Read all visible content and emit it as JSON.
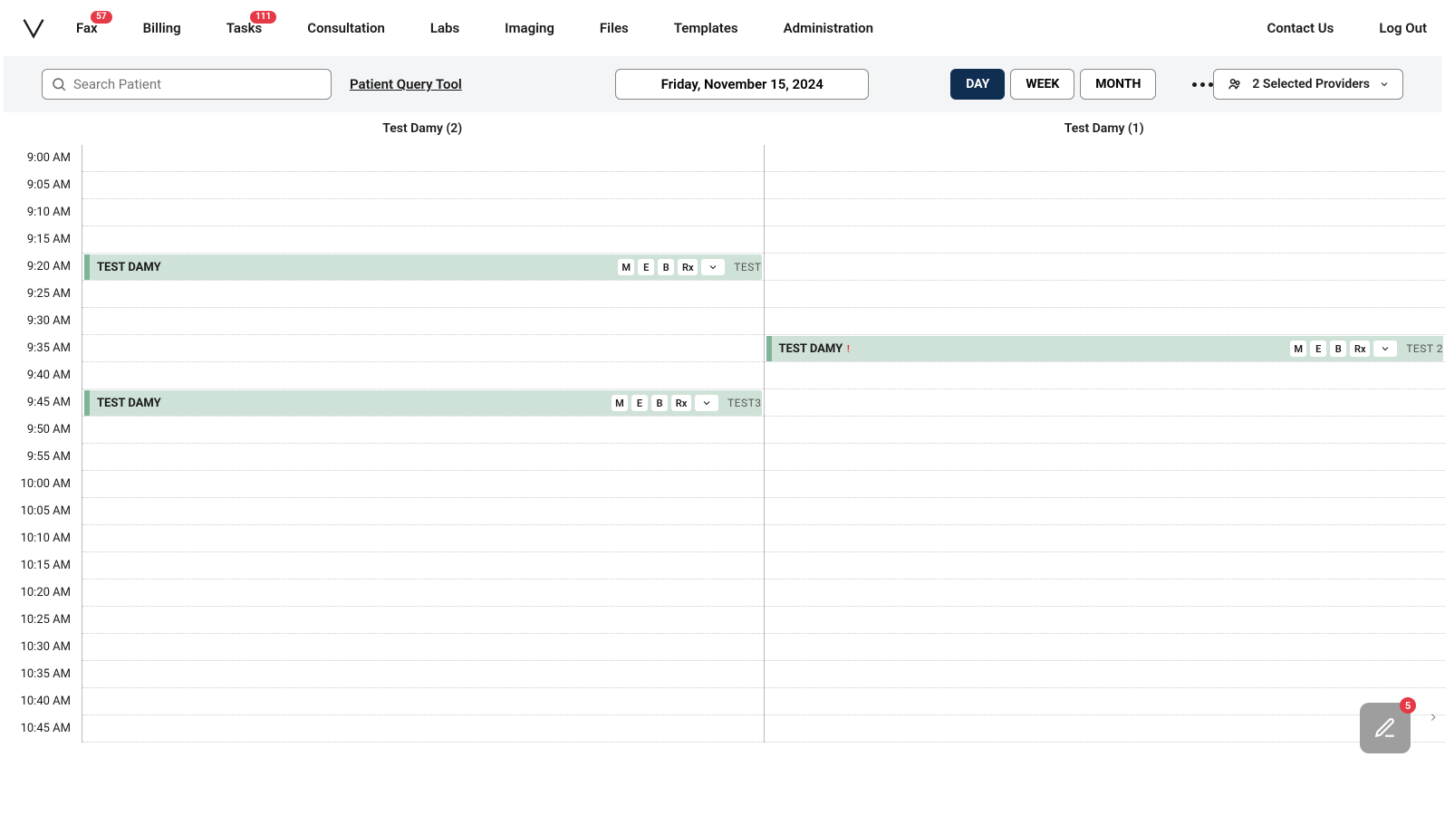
{
  "nav": {
    "items": [
      {
        "label": "Fax",
        "badge": "57"
      },
      {
        "label": "Billing"
      },
      {
        "label": "Tasks",
        "badge": "111"
      },
      {
        "label": "Consultation"
      },
      {
        "label": "Labs"
      },
      {
        "label": "Imaging"
      },
      {
        "label": "Files"
      },
      {
        "label": "Templates"
      },
      {
        "label": "Administration"
      }
    ],
    "right": [
      {
        "label": "Contact Us"
      },
      {
        "label": "Log Out"
      }
    ]
  },
  "toolbar": {
    "search_placeholder": "Search Patient",
    "query_tool_label": "Patient Query Tool",
    "date_label": "Friday, November 15, 2024",
    "views": {
      "day": "DAY",
      "week": "WEEK",
      "month": "MONTH"
    },
    "providers_label": "2 Selected Providers"
  },
  "columns": [
    {
      "header": "Test Damy (2)"
    },
    {
      "header": "Test Damy (1)"
    }
  ],
  "time_slots": [
    "9:00 AM",
    "9:05 AM",
    "9:10 AM",
    "9:15 AM",
    "9:20 AM",
    "9:25 AM",
    "9:30 AM",
    "9:35 AM",
    "9:40 AM",
    "9:45 AM",
    "9:50 AM",
    "9:55 AM",
    "10:00 AM",
    "10:05 AM",
    "10:10 AM",
    "10:15 AM",
    "10:20 AM",
    "10:25 AM",
    "10:30 AM",
    "10:35 AM",
    "10:40 AM",
    "10:45 AM"
  ],
  "appointments": [
    {
      "col": 0,
      "slot_index": 4,
      "patient": "TEST DAMY",
      "note": "TEST",
      "alert": false
    },
    {
      "col": 0,
      "slot_index": 9,
      "patient": "TEST DAMY",
      "note": "TEST3",
      "alert": false
    },
    {
      "col": 1,
      "slot_index": 7,
      "patient": "TEST DAMY",
      "note": "TEST 2",
      "alert": true
    }
  ],
  "appt_buttons": {
    "m": "M",
    "e": "E",
    "b": "B",
    "rx": "Rx"
  },
  "fab": {
    "badge": "5"
  }
}
